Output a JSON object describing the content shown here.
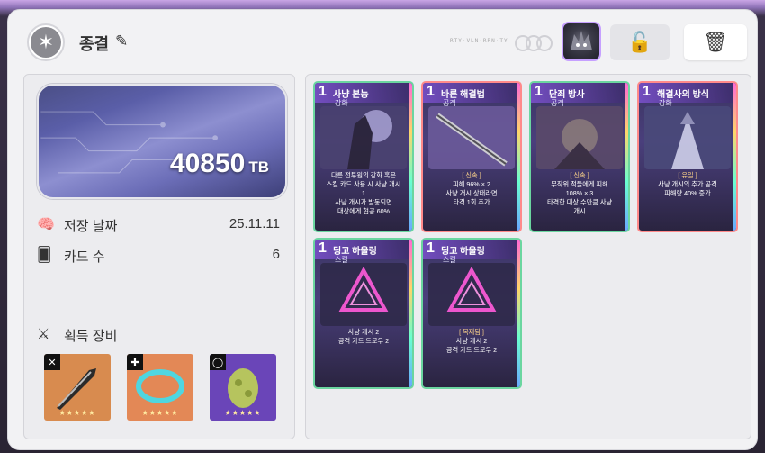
{
  "header": {
    "title": "종결",
    "code_text": "RTY·VLN·RRN·TY",
    "lock_icon": "unlock-icon",
    "trash_icon": "trash-icon"
  },
  "summary": {
    "storage_value": "40850",
    "storage_unit": "TB",
    "stats": [
      {
        "icon": "brain-icon",
        "label": "저장 날짜",
        "value": "25.11.11"
      },
      {
        "icon": "card-icon",
        "label": "카드 수",
        "value": "6"
      }
    ],
    "equipment_title": "획득 장비",
    "equipment": [
      {
        "icon": "sword-icon",
        "bg": "#d88b4f",
        "stars": "★★★★★"
      },
      {
        "icon": "bracelet-icon",
        "bg": "#e38856",
        "stars": "★★★★★"
      },
      {
        "icon": "egg-icon",
        "bg": "#6a45b8",
        "stars": "★★★★★"
      }
    ]
  },
  "cards": [
    {
      "cost": "1",
      "name": "사냥 본능",
      "type": "강화",
      "lines": [
        "다른 전투원의 강화 혹은",
        "스킬 카드 사용 시 사냥 개시",
        "1",
        "사냥 개시가 발동되면",
        "대상에게 협공 60%"
      ]
    },
    {
      "cost": "1",
      "name": "바른 해결법",
      "type": "공격",
      "keyword": "[ 신속 ]",
      "lines": [
        "피해 96% × 2",
        "사냥 개시 상태라면",
        "타격 1회 추가"
      ]
    },
    {
      "cost": "1",
      "name": "단죄 방사",
      "type": "공격",
      "keyword": "[ 신속 ]",
      "lines": [
        "무작위 적들에게 피해",
        "108% × 3",
        "타격한 대상 수만큼 사냥",
        "개시"
      ]
    },
    {
      "cost": "1",
      "name": "해결사의 방식",
      "type": "강화",
      "keyword": "[ 유일 ]",
      "lines": [
        "사냥 개시의 추가 공격",
        "피해량 40% 증가"
      ]
    },
    {
      "cost": "1",
      "name": "딩고 하울링",
      "type": "스킬",
      "lines": [
        "사냥 개시 2",
        "공격 카드 드로우 2"
      ]
    },
    {
      "cost": "1",
      "name": "딩고 하울링",
      "type": "스킬",
      "keyword": "[ 복제됨 ]",
      "lines": [
        "사냥 개시 2",
        "공격 카드 드로우 2"
      ]
    }
  ]
}
